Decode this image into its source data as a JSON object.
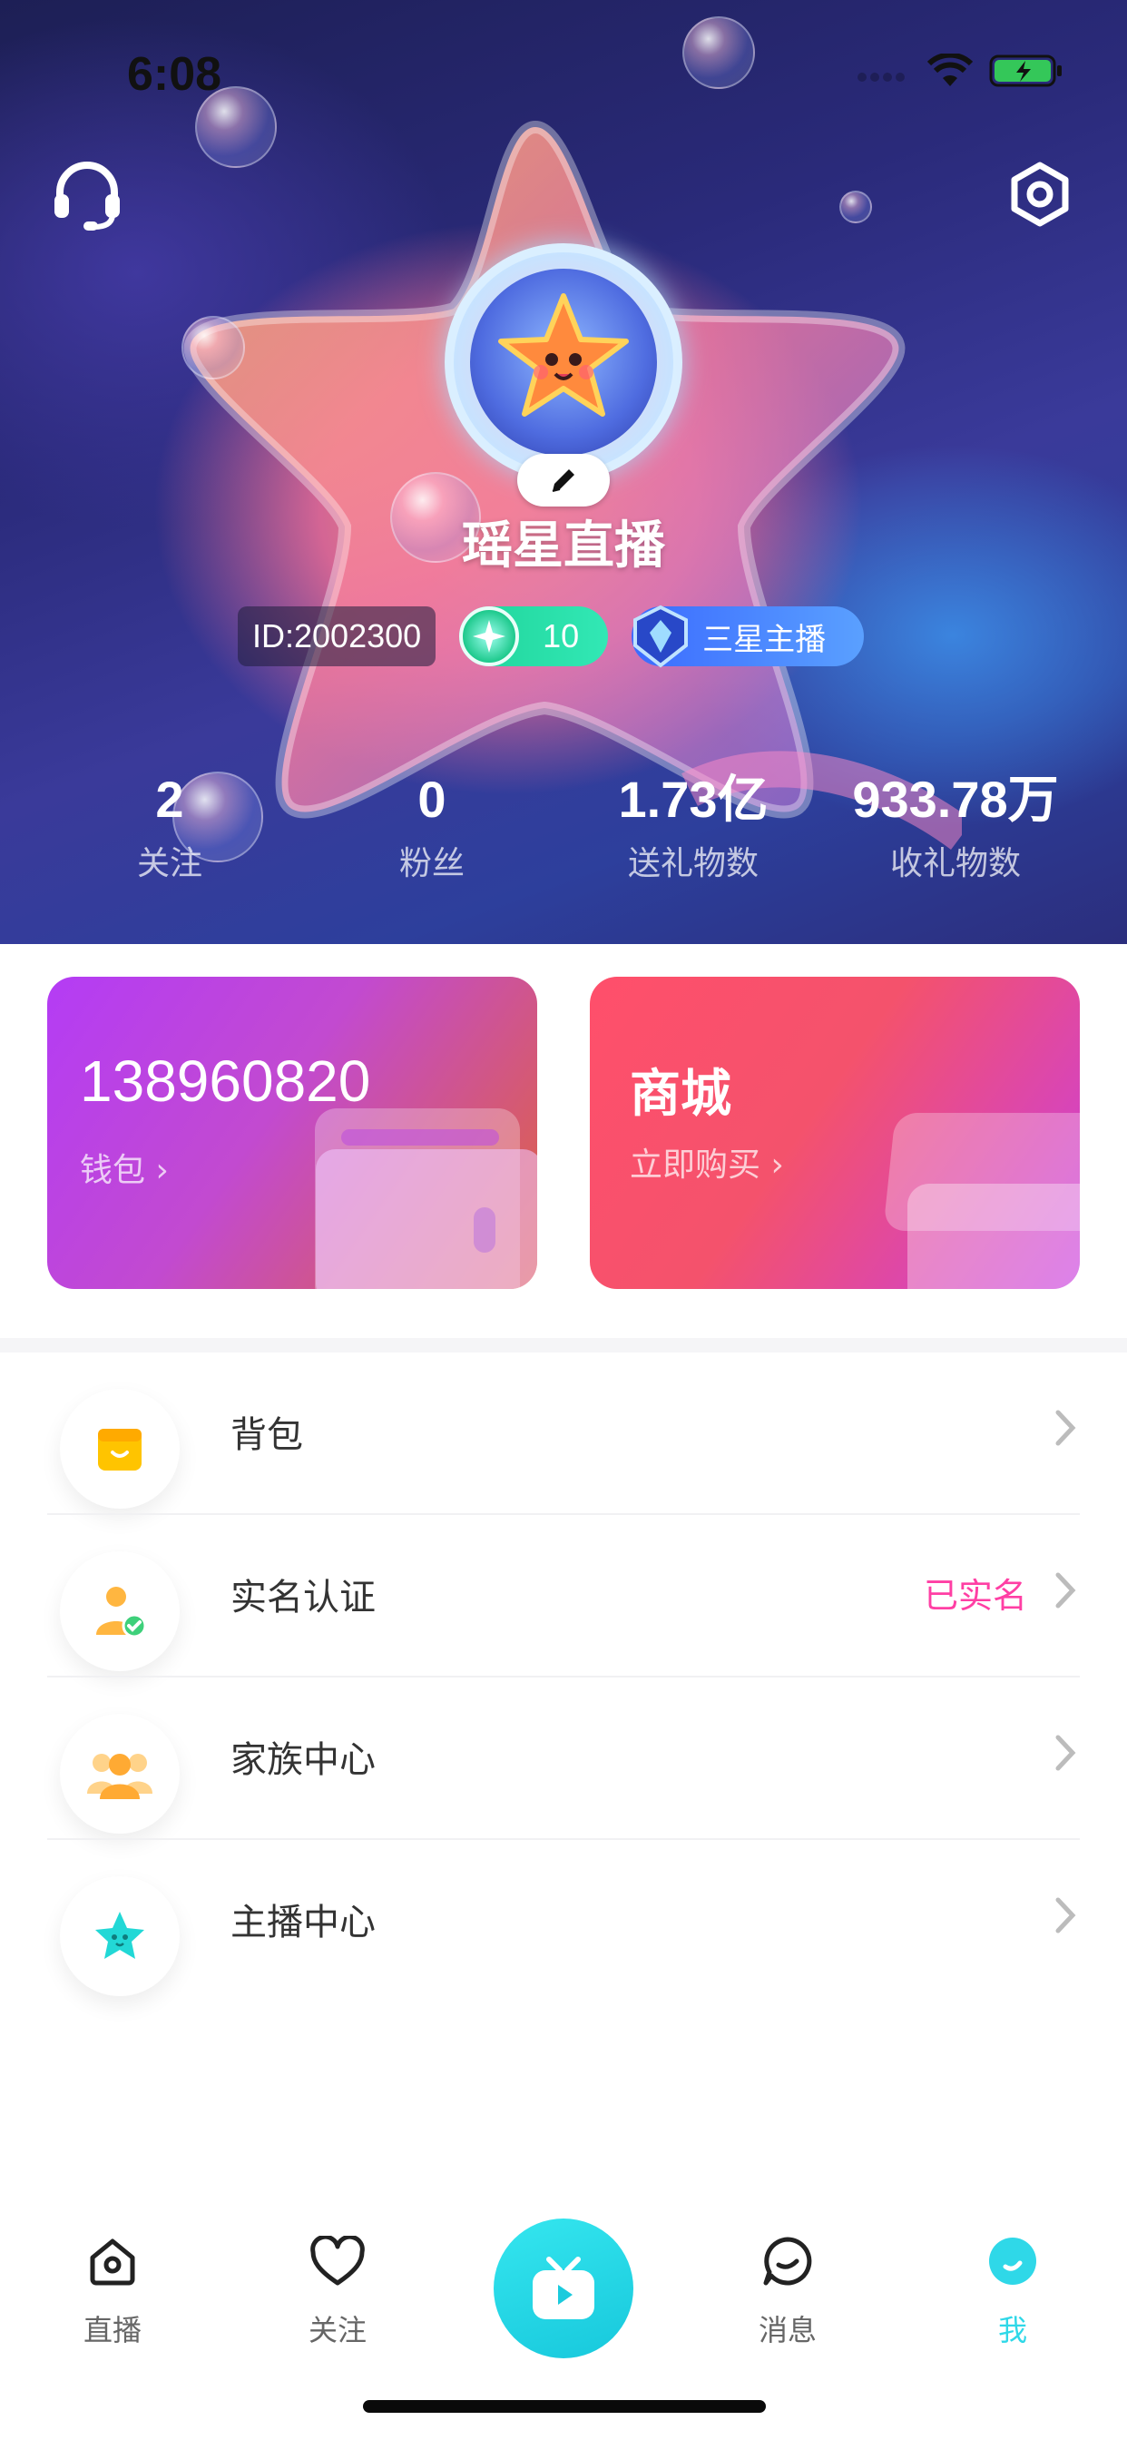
{
  "status_bar": {
    "time": "6:08"
  },
  "profile": {
    "nickname": "瑶星直播",
    "id_text": "ID:2002300",
    "level": "10",
    "anchor_rank": "三星主播"
  },
  "stats": [
    {
      "value": "2",
      "label": "关注"
    },
    {
      "value": "0",
      "label": "粉丝"
    },
    {
      "value": "1.73亿",
      "label": "送礼物数"
    },
    {
      "value": "933.78万",
      "label": "收礼物数"
    }
  ],
  "cards": {
    "wallet": {
      "amount": "138960820",
      "link": "钱包 ›"
    },
    "mall": {
      "title": "商城",
      "link": "立即购买 ›"
    }
  },
  "menu": [
    {
      "label": "背包",
      "extra": "",
      "icon": "backpack-icon"
    },
    {
      "label": "实名认证",
      "extra": "已实名",
      "icon": "verified-user-icon"
    },
    {
      "label": "家族中心",
      "extra": "",
      "icon": "family-icon"
    },
    {
      "label": "主播中心",
      "extra": "",
      "icon": "star-icon"
    }
  ],
  "tabs": [
    {
      "label": "直播",
      "icon": "home-icon"
    },
    {
      "label": "关注",
      "icon": "heart-icon"
    },
    {
      "label": "",
      "icon": "tv-play-icon"
    },
    {
      "label": "消息",
      "icon": "chat-icon"
    },
    {
      "label": "我",
      "icon": "me-icon",
      "active": true
    }
  ],
  "colors": {
    "accent": "#2fd8e8",
    "verified": "#ff3fa4",
    "level_badge": "#1fd49a",
    "anchor_badge": "#3b6bff"
  }
}
